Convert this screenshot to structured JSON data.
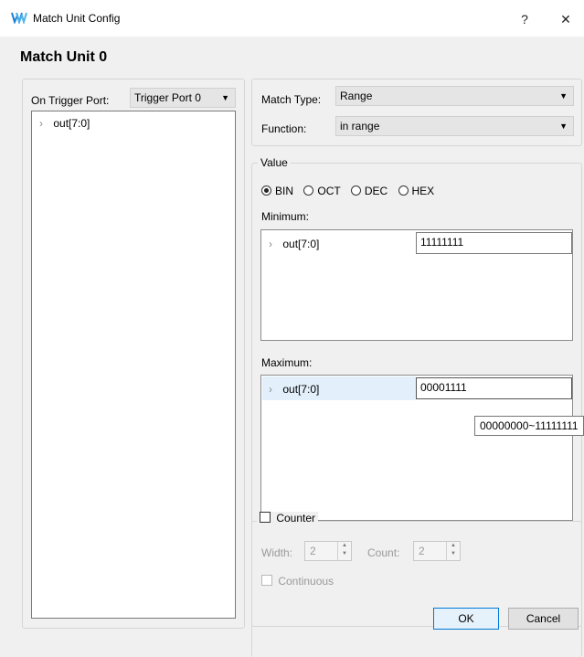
{
  "window": {
    "title": "Match Unit Config",
    "help_label": "?",
    "close_label": "✕",
    "app_icon": "gowin-logo-icon"
  },
  "heading": "Match Unit 0",
  "left_panel": {
    "trigger_port_label": "On Trigger Port:",
    "trigger_port_value": "Trigger Port 0",
    "tree_items": [
      {
        "label": "out[7:0]"
      }
    ]
  },
  "match": {
    "match_type_label": "Match Type:",
    "match_type_value": "Range",
    "function_label": "Function:",
    "function_value": "in range"
  },
  "value": {
    "group_label": "Value",
    "radix_options": [
      {
        "label": "BIN",
        "selected": true
      },
      {
        "label": "OCT",
        "selected": false
      },
      {
        "label": "DEC",
        "selected": false
      },
      {
        "label": "HEX",
        "selected": false
      }
    ],
    "minimum_label": "Minimum:",
    "minimum_signal": "out[7:0]",
    "minimum_value": "11111111",
    "maximum_label": "Maximum:",
    "maximum_signal": "out[7:0]",
    "maximum_value": "00001111",
    "tooltip": "00000000~11111111"
  },
  "counter": {
    "label": "Counter",
    "checked": false,
    "width_label": "Width:",
    "width_value": "2",
    "count_label": "Count:",
    "count_value": "2",
    "continuous_label": "Continuous"
  },
  "buttons": {
    "ok": "OK",
    "cancel": "Cancel"
  },
  "colors": {
    "accent": "#0078d7",
    "selected_row": "#e3f0fb"
  }
}
